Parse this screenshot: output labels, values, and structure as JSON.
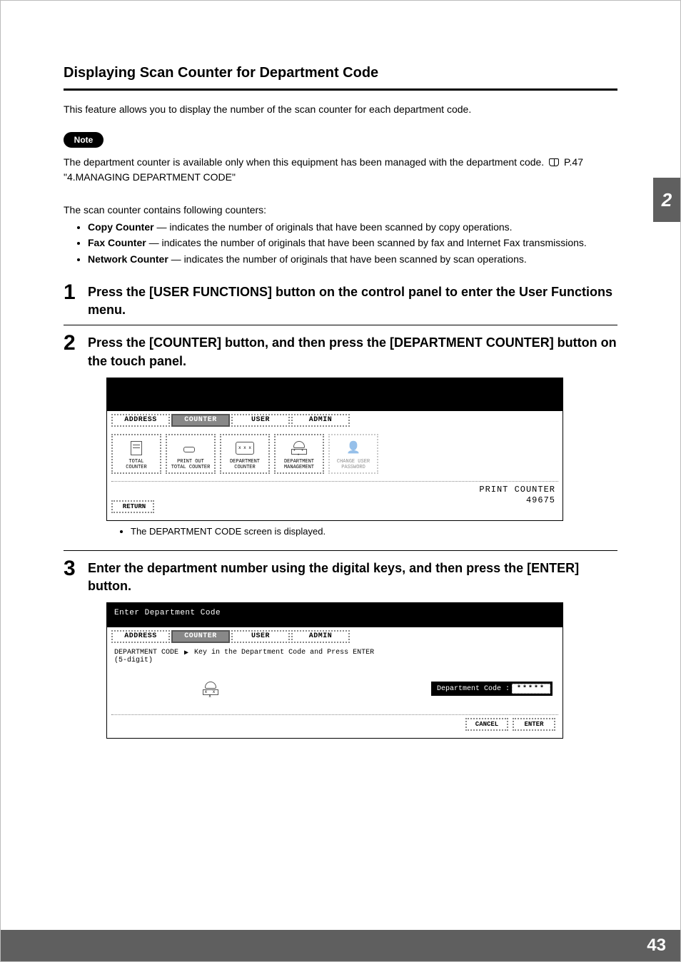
{
  "section": {
    "heading": "Displaying Scan Counter for Department Code",
    "intro": "This feature allows you to display the number of the scan counter for each department code."
  },
  "note": {
    "badge": "Note",
    "text_before": "The department counter is available only when this equipment has been managed with the department code.",
    "ref": "P.47 \"4.MANAGING DEPARTMENT CODE\""
  },
  "counters": {
    "lead": "The scan counter contains following counters:",
    "items": [
      {
        "term": "Copy Counter",
        "desc": " — indicates the number of originals that have been scanned by copy operations."
      },
      {
        "term": "Fax Counter",
        "desc": " — indicates the number of originals that have been scanned by fax and Internet Fax transmissions."
      },
      {
        "term": "Network Counter",
        "desc": " — indicates the number of originals that have been scanned by scan operations."
      }
    ]
  },
  "steps": {
    "s1": "Press the [USER FUNCTIONS] button on the control panel to enter the User Functions menu.",
    "s2": "Press the [COUNTER] button, and then press the [DEPARTMENT COUNTER] button on the touch panel.",
    "s2_sub": "The DEPARTMENT CODE screen is displayed.",
    "s3": "Enter the department number using the digital keys, and then press the [ENTER] button."
  },
  "panel1": {
    "tabs": {
      "address": "ADDRESS",
      "counter": "COUNTER",
      "user": "USER",
      "admin": "ADMIN"
    },
    "cells": {
      "total": "TOTAL\nCOUNTER",
      "printout": "PRINT OUT\nTOTAL COUNTER",
      "deptcounter": "DEPARTMENT\nCOUNTER",
      "deptmgmt": "DEPARTMENT\nMANAGEMENT",
      "changepw": "CHANGE USER\nPASSWORD"
    },
    "return": "RETURN",
    "print_label": "PRINT COUNTER",
    "print_value": "49675"
  },
  "panel2": {
    "top": "Enter Department Code",
    "tabs": {
      "address": "ADDRESS",
      "counter": "COUNTER",
      "user": "USER",
      "admin": "ADMIN"
    },
    "hint_label": "DEPARTMENT CODE\n(5-digit)",
    "hint_text": "Key in the Department Code and Press ENTER",
    "field_label": "Department Code :",
    "mask": "*****",
    "cancel": "CANCEL",
    "enter": "ENTER"
  },
  "chrome": {
    "side_tab": "2",
    "page_number": "43"
  }
}
